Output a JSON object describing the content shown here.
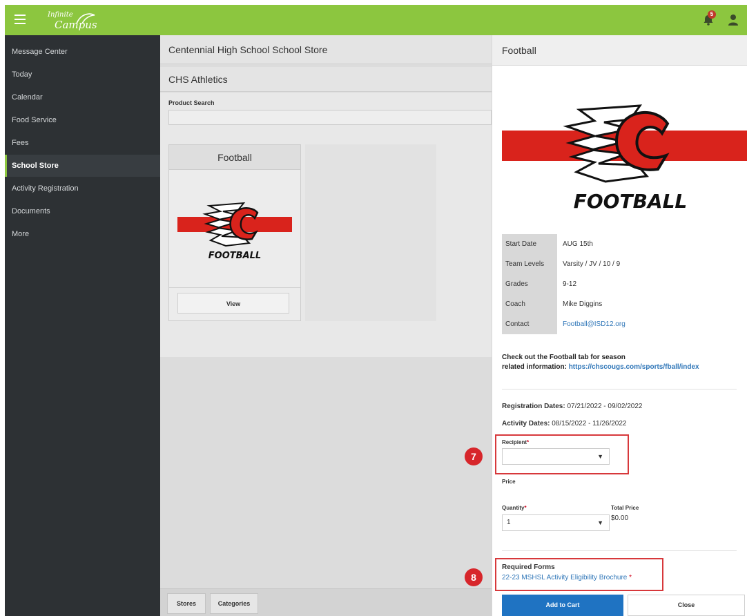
{
  "app": {
    "logo_line1": "Infinite",
    "logo_line2": "Campus",
    "notification_count": "5"
  },
  "sidebar": {
    "items": [
      {
        "label": "Message Center"
      },
      {
        "label": "Today"
      },
      {
        "label": "Calendar"
      },
      {
        "label": "Food Service"
      },
      {
        "label": "Fees"
      },
      {
        "label": "School Store"
      },
      {
        "label": "Activity Registration"
      },
      {
        "label": "Documents"
      },
      {
        "label": "More"
      }
    ],
    "active": "School Store"
  },
  "main": {
    "store_title": "Centennial High School School Store",
    "category_title": "CHS Athletics",
    "search_label": "Product Search",
    "product_card": {
      "title": "Football",
      "logo_text": "FOOTBALL",
      "view_label": "View"
    },
    "footer": {
      "stores_label": "Stores",
      "categories_label": "Categories"
    }
  },
  "panel": {
    "title": "Football",
    "logo_text": "FOOTBALL",
    "info": [
      {
        "key": "Start Date",
        "value": "AUG 15th"
      },
      {
        "key": "Team Levels",
        "value": "Varsity / JV / 10 / 9"
      },
      {
        "key": "Grades",
        "value": "9-12"
      },
      {
        "key": "Coach",
        "value": "Mike Diggins"
      },
      {
        "key": "Contact",
        "value": "Football@ISD12.org"
      }
    ],
    "description_line1": "Check out the Football tab for season",
    "description_line2": "related information:",
    "description_link": "https://chscougs.com/sports/fball/index",
    "registration_label": "Registration Dates:",
    "registration_value": "07/21/2022 - 09/02/2022",
    "activity_label": "Activity Dates:",
    "activity_value": "08/15/2022 - 11/26/2022",
    "recipient_label": "Recipient",
    "recipient_value": "",
    "price_label": "Price",
    "quantity_label": "Quantity",
    "quantity_value": "1",
    "total_label": "Total Price",
    "total_value": "$0.00",
    "required_forms_label": "Required Forms",
    "required_form_link": "22-23 MSHSL Activity Eligibility Brochure",
    "add_to_cart_label": "Add to Cart",
    "close_label": "Close",
    "callout_recipient": "7",
    "callout_forms": "8",
    "required_marker": "*"
  },
  "colors": {
    "topbar": "#8cc63f",
    "sidebar": "#2d3134",
    "link": "#2f76b8",
    "primary_button": "#1f73c2",
    "callout": "#d7262b",
    "logo_red": "#d9231c"
  }
}
